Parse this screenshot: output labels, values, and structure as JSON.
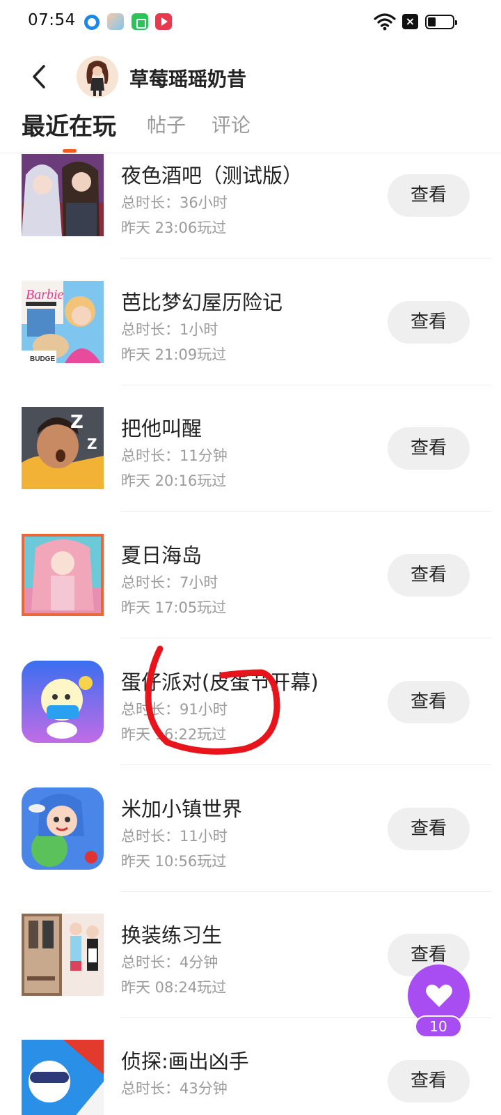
{
  "status_bar": {
    "time": "07:54",
    "icons": [
      "app-notification-icon",
      "game-app-icon",
      "green-app-icon",
      "video-app-icon",
      "wifi-icon",
      "no-sim-icon",
      "battery-icon"
    ]
  },
  "header": {
    "username": "草莓瑶瑶奶昔"
  },
  "tabs": [
    {
      "label": "最近在玩",
      "active": true
    },
    {
      "label": "帖子",
      "active": false
    },
    {
      "label": "评论",
      "active": false
    }
  ],
  "games": [
    {
      "name": "夜色酒吧（测试版）",
      "duration": "总时长：36小时",
      "last_played": "昨天 23:06玩过",
      "button": "查看"
    },
    {
      "name": "芭比梦幻屋历险记",
      "duration": "总时长：1小时",
      "last_played": "昨天 21:09玩过",
      "button": "查看"
    },
    {
      "name": "把他叫醒",
      "duration": "总时长：11分钟",
      "last_played": "昨天 20:16玩过",
      "button": "查看"
    },
    {
      "name": "夏日海岛",
      "duration": "总时长：7小时",
      "last_played": "昨天 17:05玩过",
      "button": "查看"
    },
    {
      "name": "蛋仔派对(皮蛋节开幕)",
      "duration": "总时长：91小时",
      "last_played": "昨天 16:22玩过",
      "button": "查看"
    },
    {
      "name": "米加小镇世界",
      "duration": "总时长：11小时",
      "last_played": "昨天 10:56玩过",
      "button": "查看"
    },
    {
      "name": "换装练习生",
      "duration": "总时长：4分钟",
      "last_played": "昨天 08:24玩过",
      "button": "查看"
    },
    {
      "name": "侦探:画出凶手",
      "duration": "总时长：43分钟",
      "last_played": "",
      "button": "查看"
    }
  ],
  "fab": {
    "count": "10",
    "color": "#a74df2"
  },
  "colors": {
    "tab_indicator": "#ff5a1e",
    "annotation": "#e8141c"
  }
}
